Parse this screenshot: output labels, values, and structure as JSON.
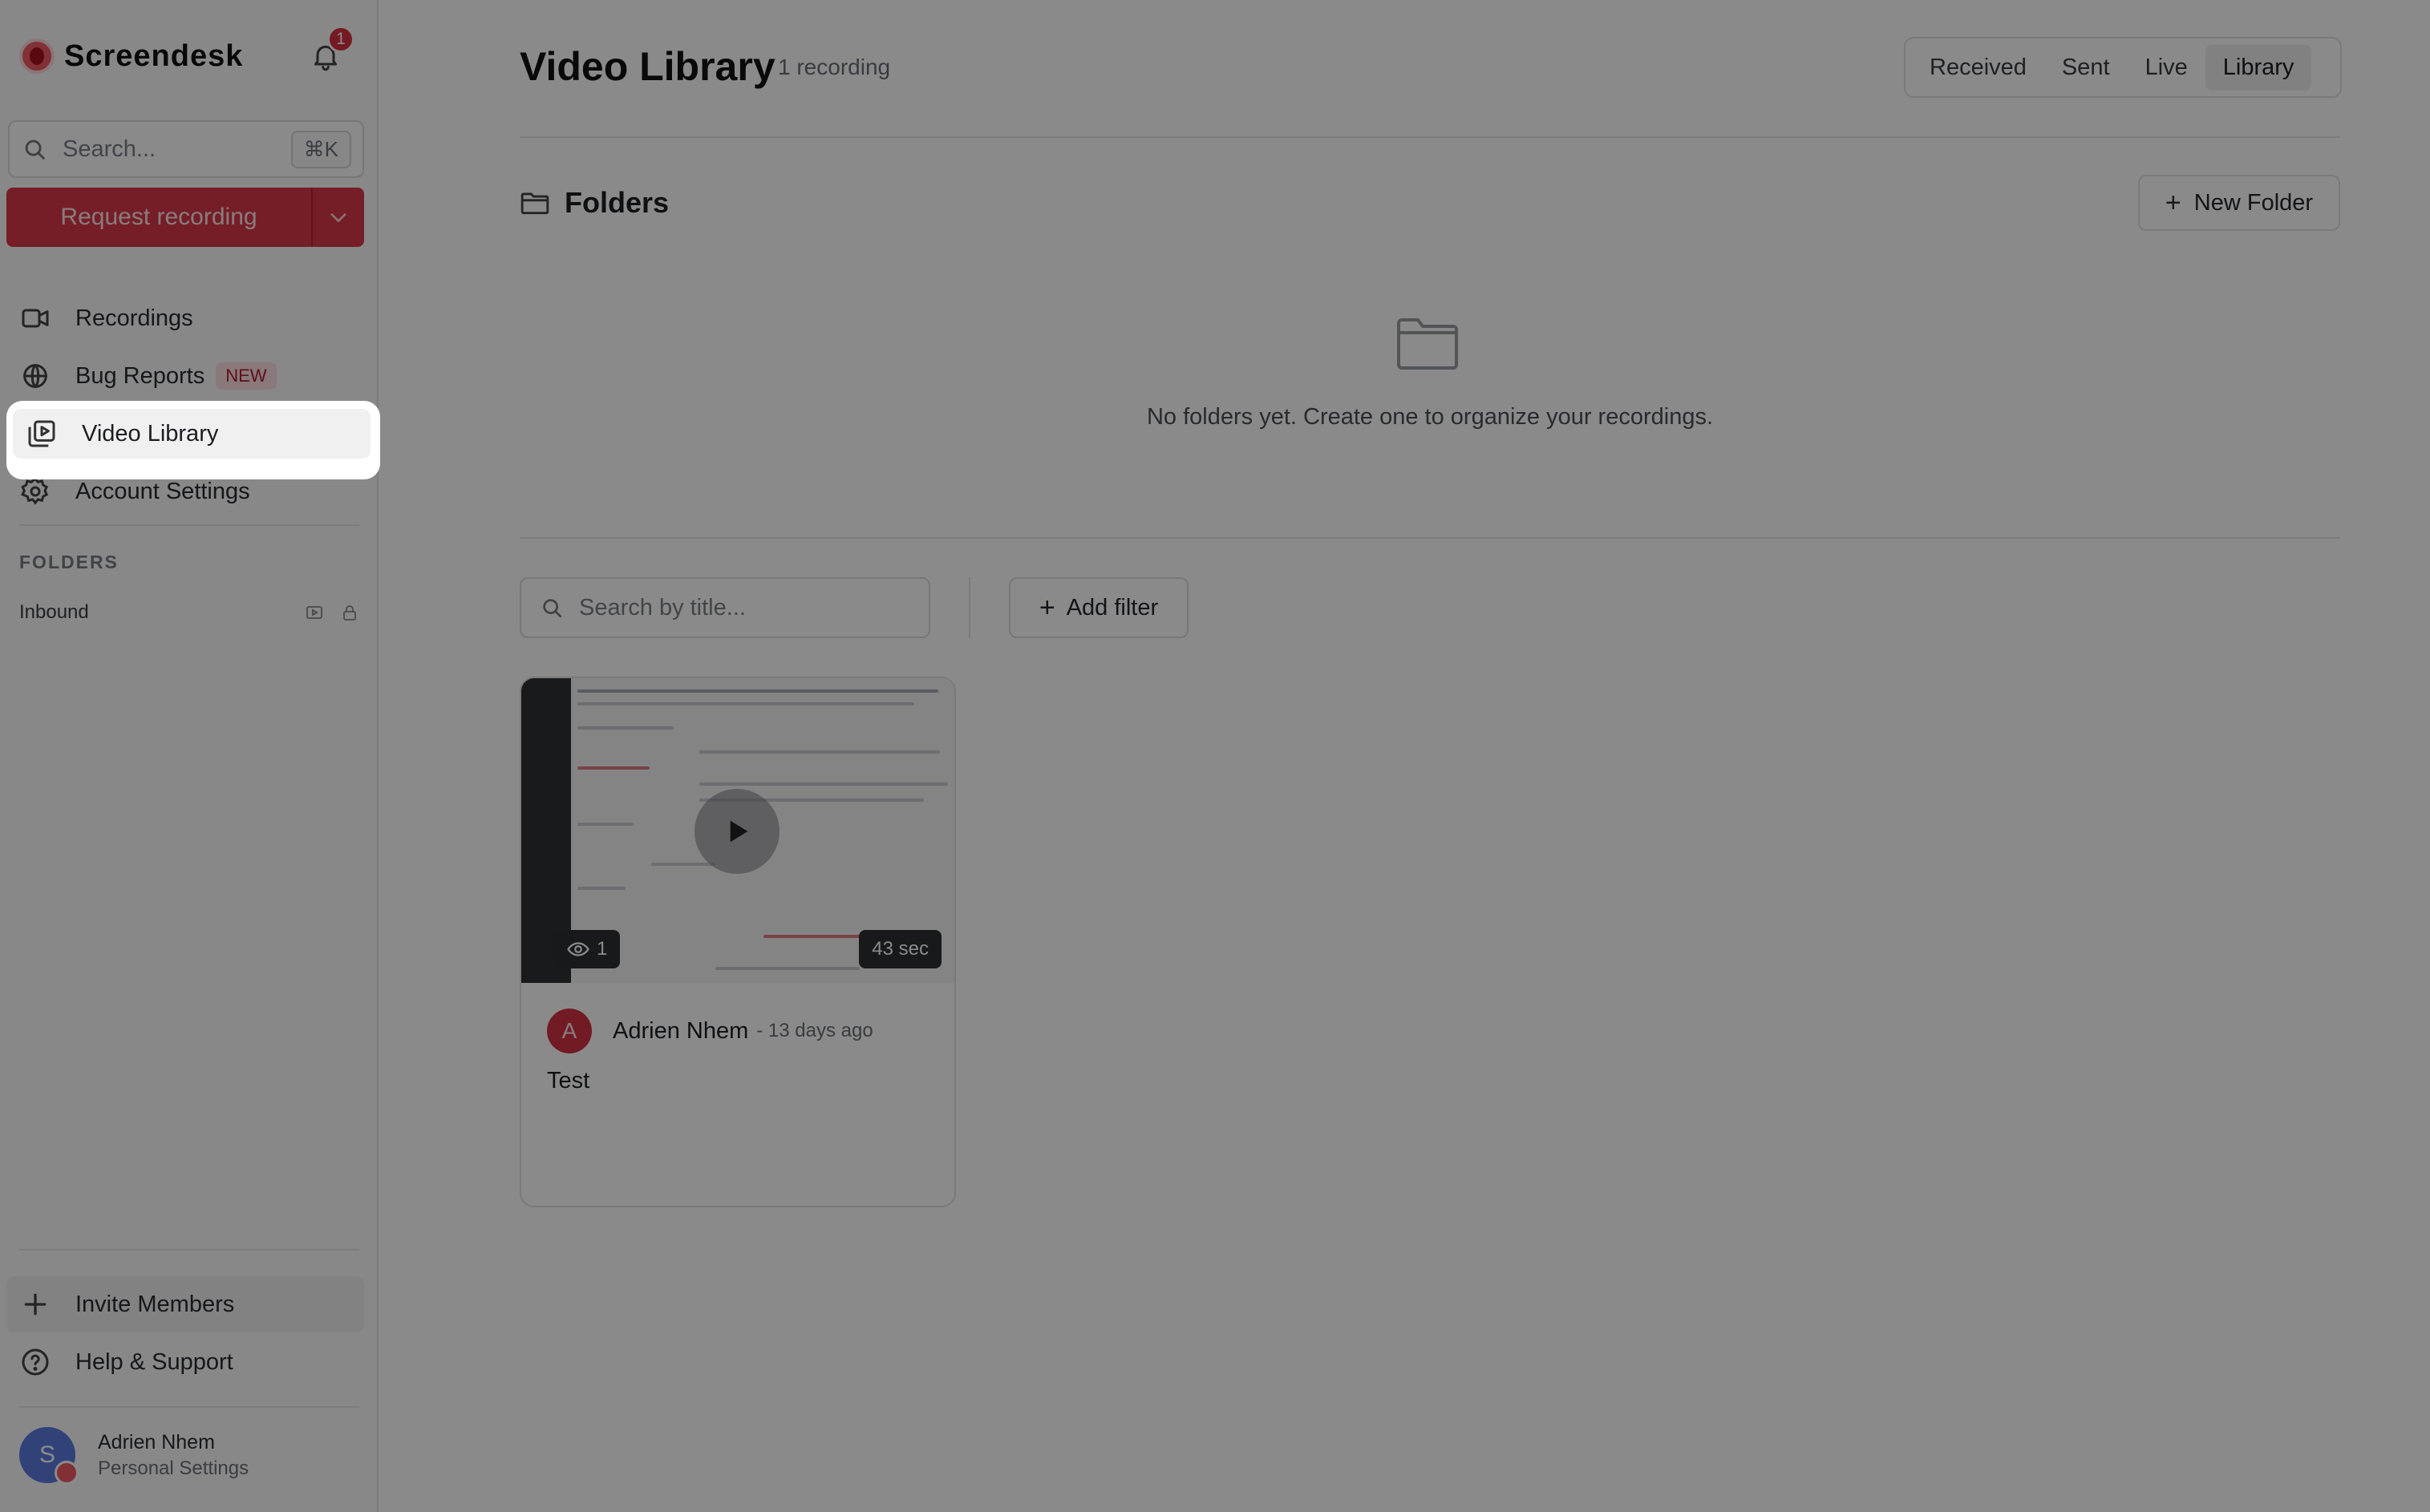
{
  "brand": {
    "name": "Screendesk",
    "notification_count": "1"
  },
  "sidebar": {
    "search_placeholder": "Search...",
    "search_shortcut": "⌘K",
    "request_button": "Request recording",
    "nav": [
      {
        "label": "Recordings",
        "icon": "video-camera-icon"
      },
      {
        "label": "Bug Reports",
        "icon": "bug-icon",
        "badge": "NEW"
      },
      {
        "label": "Video Library",
        "icon": "library-icon",
        "active": true
      },
      {
        "label": "Account Settings",
        "icon": "gear-icon"
      }
    ],
    "folders_label": "FOLDERS",
    "folders": [
      {
        "name": "Inbound"
      }
    ],
    "bottom": [
      {
        "label": "Invite Members",
        "icon": "plus-icon"
      },
      {
        "label": "Help & Support",
        "icon": "help-circle-icon"
      }
    ],
    "user": {
      "initial": "S",
      "name": "Adrien Nhem",
      "subtitle": "Personal Settings"
    }
  },
  "main": {
    "title": "Video Library",
    "count": "1 recording",
    "tabs": [
      {
        "label": "Received"
      },
      {
        "label": "Sent"
      },
      {
        "label": "Live"
      },
      {
        "label": "Library",
        "active": true
      }
    ],
    "folders_title": "Folders",
    "new_folder_button": "New Folder",
    "empty_message": "No folders yet. Create one to organize your recordings.",
    "search_placeholder": "Search by title...",
    "add_filter_button": "Add filter",
    "recordings": [
      {
        "views": "1",
        "duration": "43 sec",
        "author_initial": "A",
        "author": "Adrien Nhem",
        "ago": "- 13 days ago",
        "title": "Test"
      }
    ]
  },
  "colors": {
    "accent": "#d8394a",
    "overlay": "rgba(0,0,0,0.46)",
    "avatar_user": "#5b7be0",
    "avatar_author": "#d23344"
  }
}
